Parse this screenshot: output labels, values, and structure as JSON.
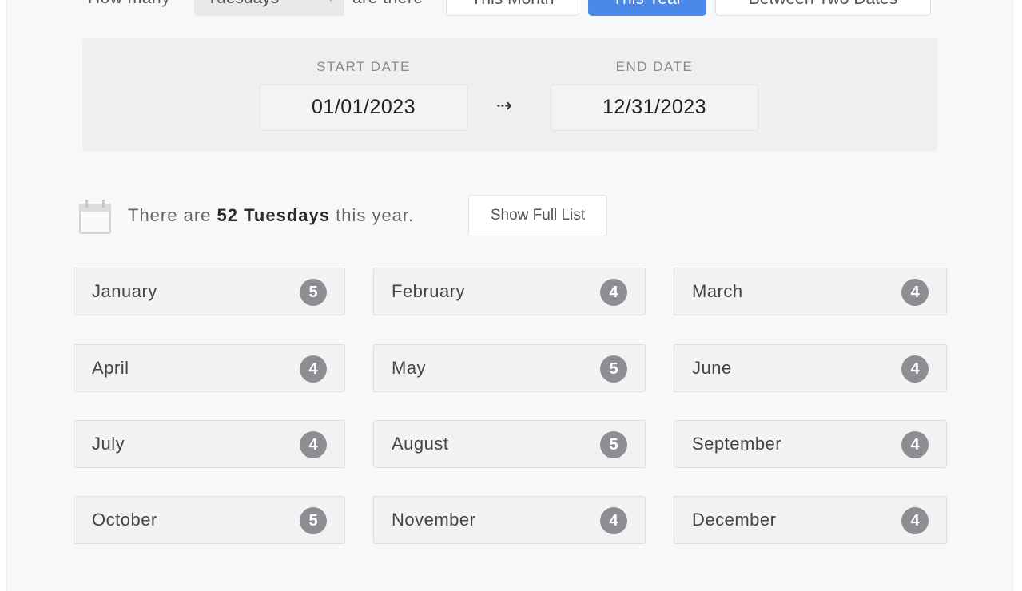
{
  "query": {
    "prefix": "How many",
    "day_select": {
      "value": "Tuesdays"
    },
    "suffix": "are there",
    "modes": [
      {
        "label": "This Month",
        "active": false
      },
      {
        "label": "This Year",
        "active": true
      },
      {
        "label": "Between Two Dates",
        "active": false
      }
    ]
  },
  "range": {
    "start_label": "START DATE",
    "start_value": "01/01/2023",
    "arrow": "⇢",
    "end_label": "END DATE",
    "end_value": "12/31/2023"
  },
  "summary": {
    "prefix": "There are",
    "count_text": "52 Tuesdays",
    "suffix": "this year.",
    "show_full_list_label": "Show Full List"
  },
  "months": [
    {
      "name": "January",
      "count": "5"
    },
    {
      "name": "February",
      "count": "4"
    },
    {
      "name": "March",
      "count": "4"
    },
    {
      "name": "April",
      "count": "4"
    },
    {
      "name": "May",
      "count": "5"
    },
    {
      "name": "June",
      "count": "4"
    },
    {
      "name": "July",
      "count": "4"
    },
    {
      "name": "August",
      "count": "5"
    },
    {
      "name": "September",
      "count": "4"
    },
    {
      "name": "October",
      "count": "5"
    },
    {
      "name": "November",
      "count": "4"
    },
    {
      "name": "December",
      "count": "4"
    }
  ],
  "colors": {
    "accent": "#4a89ea",
    "badge": "#8d8e93",
    "panel": "#efeff0",
    "background": "#f7f8fa"
  }
}
